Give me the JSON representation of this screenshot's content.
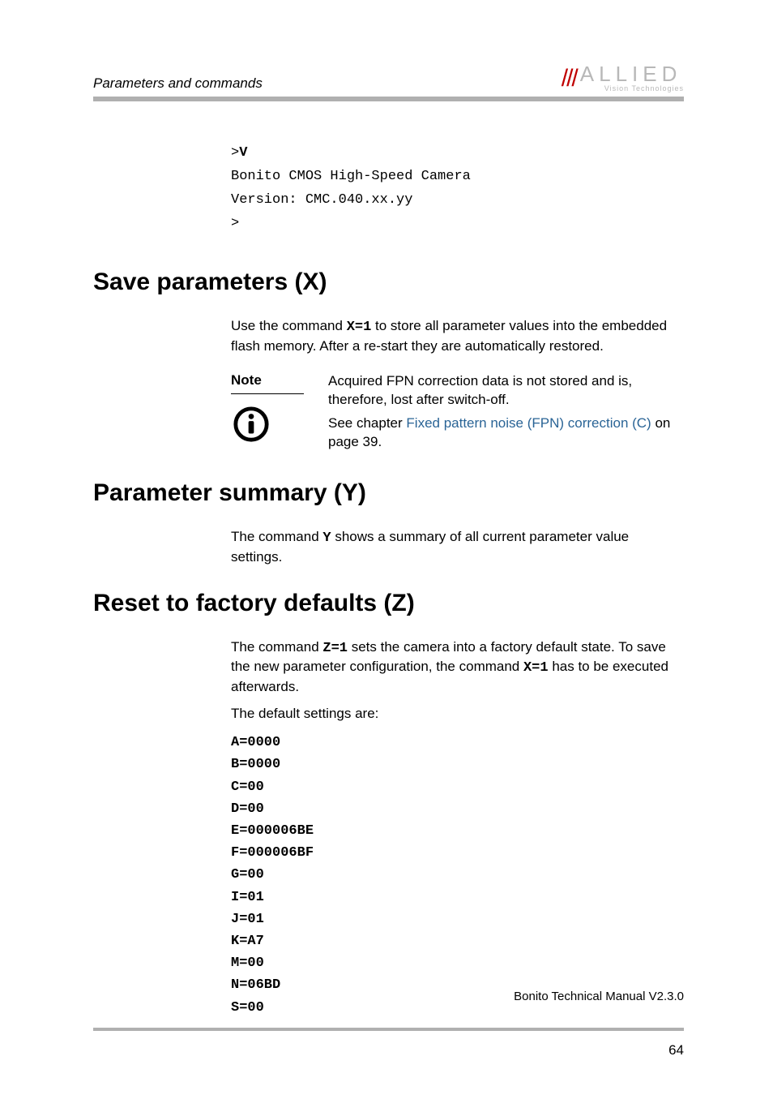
{
  "header": {
    "section_title": "Parameters and commands",
    "logo": {
      "main": "ALLIED",
      "sub": "Vision Technologies"
    }
  },
  "terminal": {
    "prompt1": ">",
    "cmd": "V",
    "line1": "Bonito CMOS High-Speed Camera",
    "line2": "Version: CMC.040.xx.yy",
    "prompt2": ">"
  },
  "sections": {
    "save": {
      "heading": "Save parameters (X)",
      "para1_a": "Use the command  ",
      "para1_cmd": "X=1",
      "para1_b": " to store all parameter values into the embedded flash memory. After a re-start they are automatically restored.",
      "note_label": "Note",
      "note_p1": "Acquired FPN correction data is not stored and is, therefore, lost after switch-off.",
      "note_p2_a": "See chapter ",
      "note_link": "Fixed pattern noise (FPN) correction (C)",
      "note_p2_b": " on page 39."
    },
    "summary": {
      "heading": "Parameter summary (Y)",
      "para_a": "The command ",
      "para_cmd": "Y",
      "para_b": " shows a summary of all current parameter value settings."
    },
    "reset": {
      "heading": "Reset to factory defaults (Z)",
      "para1_a": "The command ",
      "para1_cmd1": "Z=1",
      "para1_b": " sets the camera into a factory default state. To save the new parameter configuration, the command ",
      "para1_cmd2": "X=1",
      "para1_c": " has to be executed afterwards.",
      "para2": "The default settings are:",
      "defaults": "A=0000\nB=0000\nC=00\nD=00\nE=000006BE\nF=000006BF\nG=00\nI=01\nJ=01\nK=A7\nM=00\nN=06BD\nS=00"
    }
  },
  "footer": {
    "doc": "Bonito Technical Manual V2.3.0",
    "page": "64"
  }
}
